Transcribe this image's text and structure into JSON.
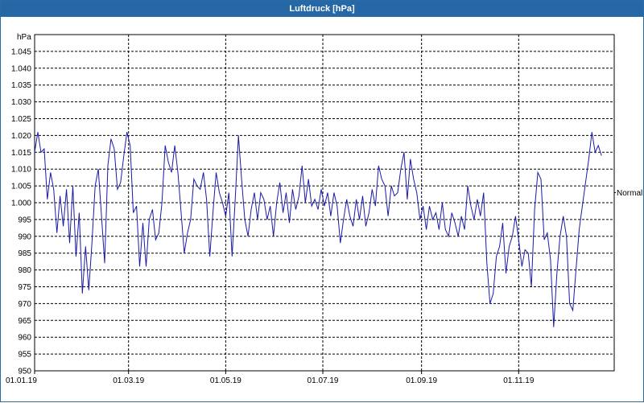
{
  "window": {
    "title": "Luftdruck [hPa]"
  },
  "chart_data": {
    "type": "line",
    "title": "Luftdruck [hPa]",
    "ylabel": "hPa",
    "ylim": [
      950,
      1050
    ],
    "yticks": [
      "950",
      "955",
      "960",
      "965",
      "970",
      "975",
      "980",
      "985",
      "990",
      "995",
      "1.000",
      "1.005",
      "1.010",
      "1.015",
      "1.020",
      "1.025",
      "1.030",
      "1.035",
      "1.040",
      "1.045"
    ],
    "xlim": [
      "2019-01-01",
      "2019-12-31"
    ],
    "xticks": [
      {
        "date": "2019-01-01",
        "label": "01.01.19"
      },
      {
        "date": "2019-03-01",
        "label": "01.03.19"
      },
      {
        "date": "2019-05-01",
        "label": "01.05.19"
      },
      {
        "date": "2019-07-01",
        "label": "01.07.19"
      },
      {
        "date": "2019-09-01",
        "label": "01.09.19"
      },
      {
        "date": "2019-11-01",
        "label": "01.11.19"
      }
    ],
    "grid": true,
    "reference_line": {
      "label": "Normal",
      "value": 1003
    },
    "series": [
      {
        "color": "#1a1aa8",
        "points": [
          [
            "2019-01-01",
            1015
          ],
          [
            "2019-01-03",
            1021
          ],
          [
            "2019-01-05",
            1015
          ],
          [
            "2019-01-07",
            1016
          ],
          [
            "2019-01-09",
            1001
          ],
          [
            "2019-01-11",
            1009
          ],
          [
            "2019-01-13",
            1004
          ],
          [
            "2019-01-15",
            991
          ],
          [
            "2019-01-17",
            1002
          ],
          [
            "2019-01-19",
            993
          ],
          [
            "2019-01-21",
            1004
          ],
          [
            "2019-01-23",
            988
          ],
          [
            "2019-01-25",
            1005
          ],
          [
            "2019-01-27",
            984
          ],
          [
            "2019-01-29",
            997
          ],
          [
            "2019-01-31",
            973
          ],
          [
            "2019-02-02",
            987
          ],
          [
            "2019-02-04",
            974
          ],
          [
            "2019-02-06",
            988
          ],
          [
            "2019-02-08",
            1005
          ],
          [
            "2019-02-10",
            1010
          ],
          [
            "2019-02-12",
            996
          ],
          [
            "2019-02-14",
            982
          ],
          [
            "2019-02-16",
            1011
          ],
          [
            "2019-02-18",
            1019
          ],
          [
            "2019-02-20",
            1016
          ],
          [
            "2019-02-22",
            1004
          ],
          [
            "2019-02-24",
            1006
          ],
          [
            "2019-02-26",
            1014
          ],
          [
            "2019-02-28",
            1021
          ],
          [
            "2019-03-02",
            1017
          ],
          [
            "2019-03-04",
            997
          ],
          [
            "2019-03-06",
            999
          ],
          [
            "2019-03-08",
            981
          ],
          [
            "2019-03-10",
            994
          ],
          [
            "2019-03-12",
            981
          ],
          [
            "2019-03-14",
            995
          ],
          [
            "2019-03-16",
            998
          ],
          [
            "2019-03-18",
            989
          ],
          [
            "2019-03-20",
            991
          ],
          [
            "2019-03-22",
            1000
          ],
          [
            "2019-03-24",
            1017
          ],
          [
            "2019-03-26",
            1012
          ],
          [
            "2019-03-28",
            1009
          ],
          [
            "2019-03-30",
            1017
          ],
          [
            "2019-04-01",
            1009
          ],
          [
            "2019-04-03",
            997
          ],
          [
            "2019-04-05",
            985
          ],
          [
            "2019-04-07",
            991
          ],
          [
            "2019-04-09",
            995
          ],
          [
            "2019-04-11",
            1007
          ],
          [
            "2019-04-13",
            1005
          ],
          [
            "2019-04-15",
            1004
          ],
          [
            "2019-04-17",
            1009
          ],
          [
            "2019-04-19",
            1001
          ],
          [
            "2019-04-21",
            984
          ],
          [
            "2019-04-23",
            997
          ],
          [
            "2019-04-25",
            1009
          ],
          [
            "2019-04-27",
            1003
          ],
          [
            "2019-04-29",
            1000
          ],
          [
            "2019-05-01",
            996
          ],
          [
            "2019-05-03",
            1003
          ],
          [
            "2019-05-05",
            984
          ],
          [
            "2019-05-07",
            1001
          ],
          [
            "2019-05-09",
            1020
          ],
          [
            "2019-05-11",
            1007
          ],
          [
            "2019-05-13",
            995
          ],
          [
            "2019-05-15",
            990
          ],
          [
            "2019-05-17",
            998
          ],
          [
            "2019-05-19",
            1003
          ],
          [
            "2019-05-21",
            995
          ],
          [
            "2019-05-23",
            1003
          ],
          [
            "2019-05-25",
            1001
          ],
          [
            "2019-05-27",
            995
          ],
          [
            "2019-05-29",
            999
          ],
          [
            "2019-05-31",
            990
          ],
          [
            "2019-06-02",
            1000
          ],
          [
            "2019-06-04",
            1006
          ],
          [
            "2019-06-06",
            997
          ],
          [
            "2019-06-08",
            1003
          ],
          [
            "2019-06-10",
            994
          ],
          [
            "2019-06-12",
            1004
          ],
          [
            "2019-06-14",
            998
          ],
          [
            "2019-06-16",
            1002
          ],
          [
            "2019-06-18",
            1011
          ],
          [
            "2019-06-20",
            1000
          ],
          [
            "2019-06-22",
            1007
          ],
          [
            "2019-06-24",
            999
          ],
          [
            "2019-06-26",
            1001
          ],
          [
            "2019-06-28",
            998
          ],
          [
            "2019-06-30",
            1004
          ],
          [
            "2019-07-02",
            999
          ],
          [
            "2019-07-04",
            1003
          ],
          [
            "2019-07-06",
            996
          ],
          [
            "2019-07-08",
            1003
          ],
          [
            "2019-07-10",
            999
          ],
          [
            "2019-07-12",
            988
          ],
          [
            "2019-07-14",
            995
          ],
          [
            "2019-07-16",
            1001
          ],
          [
            "2019-07-18",
            996
          ],
          [
            "2019-07-20",
            993
          ],
          [
            "2019-07-22",
            1001
          ],
          [
            "2019-07-24",
            995
          ],
          [
            "2019-07-26",
            1002
          ],
          [
            "2019-07-28",
            993
          ],
          [
            "2019-07-30",
            997
          ],
          [
            "2019-08-01",
            1004
          ],
          [
            "2019-08-03",
            999
          ],
          [
            "2019-08-05",
            1011
          ],
          [
            "2019-08-07",
            1007
          ],
          [
            "2019-08-09",
            1005
          ],
          [
            "2019-08-11",
            996
          ],
          [
            "2019-08-13",
            1005
          ],
          [
            "2019-08-15",
            1002
          ],
          [
            "2019-08-17",
            1003
          ],
          [
            "2019-08-19",
            1010
          ],
          [
            "2019-08-21",
            1015
          ],
          [
            "2019-08-23",
            1001
          ],
          [
            "2019-08-25",
            1013
          ],
          [
            "2019-08-27",
            1007
          ],
          [
            "2019-08-29",
            1003
          ],
          [
            "2019-08-31",
            995
          ],
          [
            "2019-09-02",
            999
          ],
          [
            "2019-09-04",
            992
          ],
          [
            "2019-09-06",
            999
          ],
          [
            "2019-09-08",
            995
          ],
          [
            "2019-09-10",
            997
          ],
          [
            "2019-09-12",
            992
          ],
          [
            "2019-09-14",
            1000
          ],
          [
            "2019-09-16",
            992
          ],
          [
            "2019-09-18",
            990
          ],
          [
            "2019-09-20",
            997
          ],
          [
            "2019-09-22",
            994
          ],
          [
            "2019-09-24",
            990
          ],
          [
            "2019-09-26",
            996
          ],
          [
            "2019-09-28",
            992
          ],
          [
            "2019-09-30",
            1005
          ],
          [
            "2019-10-02",
            999
          ],
          [
            "2019-10-04",
            995
          ],
          [
            "2019-10-06",
            1001
          ],
          [
            "2019-10-08",
            996
          ],
          [
            "2019-10-10",
            1003
          ],
          [
            "2019-10-12",
            982
          ],
          [
            "2019-10-14",
            970
          ],
          [
            "2019-10-16",
            973
          ],
          [
            "2019-10-18",
            984
          ],
          [
            "2019-10-20",
            987
          ],
          [
            "2019-10-22",
            994
          ],
          [
            "2019-10-24",
            979
          ],
          [
            "2019-10-26",
            987
          ],
          [
            "2019-10-28",
            990
          ],
          [
            "2019-10-30",
            996
          ],
          [
            "2019-11-01",
            989
          ],
          [
            "2019-11-03",
            981
          ],
          [
            "2019-11-05",
            986
          ],
          [
            "2019-11-07",
            985
          ],
          [
            "2019-11-09",
            975
          ],
          [
            "2019-11-11",
            998
          ],
          [
            "2019-11-13",
            1009
          ],
          [
            "2019-11-15",
            1007
          ],
          [
            "2019-11-17",
            989
          ],
          [
            "2019-11-19",
            991
          ],
          [
            "2019-11-21",
            983
          ],
          [
            "2019-11-23",
            963
          ],
          [
            "2019-11-25",
            979
          ],
          [
            "2019-11-27",
            990
          ],
          [
            "2019-11-29",
            996
          ],
          [
            "2019-12-01",
            990
          ],
          [
            "2019-12-03",
            970
          ],
          [
            "2019-12-05",
            968
          ],
          [
            "2019-12-07",
            980
          ],
          [
            "2019-12-09",
            992
          ],
          [
            "2019-12-11",
            999
          ],
          [
            "2019-12-13",
            1006
          ],
          [
            "2019-12-15",
            1013
          ],
          [
            "2019-12-17",
            1021
          ],
          [
            "2019-12-19",
            1015
          ],
          [
            "2019-12-21",
            1017
          ],
          [
            "2019-12-23",
            1014
          ]
        ]
      }
    ]
  }
}
